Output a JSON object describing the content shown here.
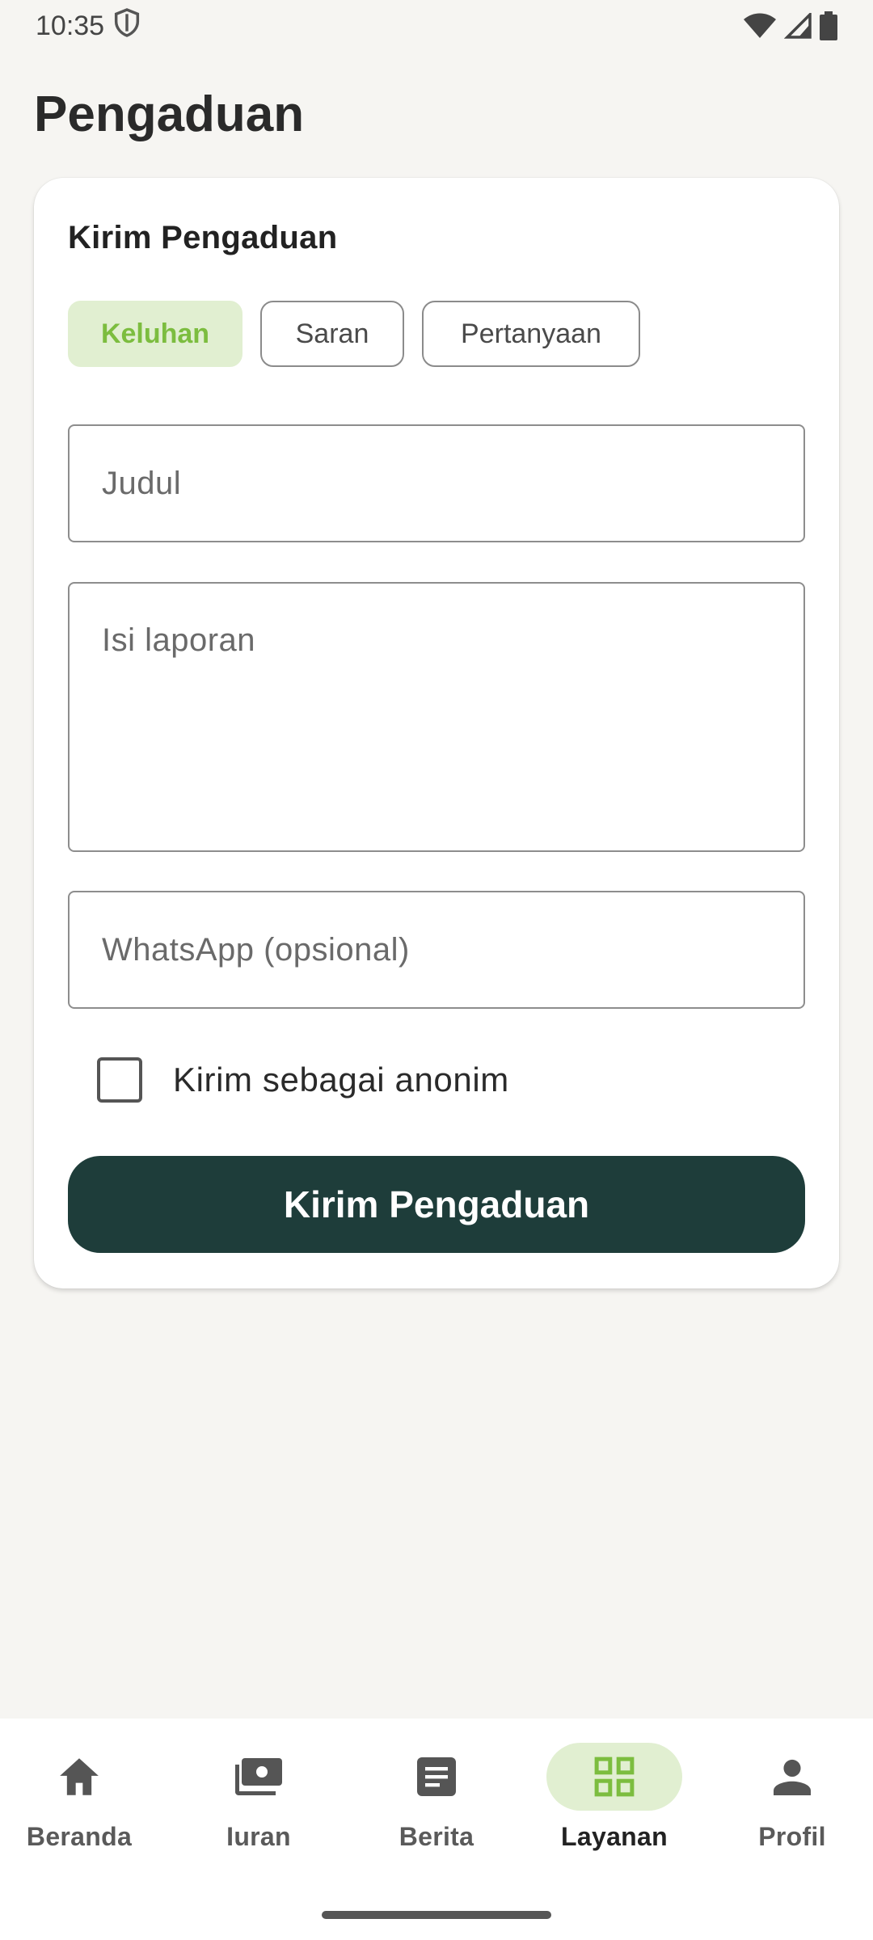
{
  "status_bar": {
    "time": "10:35"
  },
  "page": {
    "title": "Pengaduan"
  },
  "form": {
    "title": "Kirim Pengaduan",
    "categories": [
      {
        "label": "Keluhan",
        "selected": true
      },
      {
        "label": "Saran",
        "selected": false
      },
      {
        "label": "Pertanyaan",
        "selected": false
      }
    ],
    "judul_placeholder": "Judul",
    "isi_placeholder": "Isi laporan",
    "whatsapp_placeholder": "WhatsApp (opsional)",
    "anonymous_label": "Kirim sebagai anonim",
    "submit_label": "Kirim Pengaduan"
  },
  "bottom_nav": {
    "items": [
      {
        "label": "Beranda",
        "icon": "home-icon",
        "active": false
      },
      {
        "label": "Iuran",
        "icon": "payments-icon",
        "active": false
      },
      {
        "label": "Berita",
        "icon": "article-icon",
        "active": false
      },
      {
        "label": "Layanan",
        "icon": "grid-icon",
        "active": true
      },
      {
        "label": "Profil",
        "icon": "person-icon",
        "active": false
      }
    ]
  },
  "colors": {
    "accent": "#7cbd3f",
    "accent_bg": "#e1efd1",
    "primary_button": "#1e3d3a",
    "background": "#f6f5f2"
  }
}
